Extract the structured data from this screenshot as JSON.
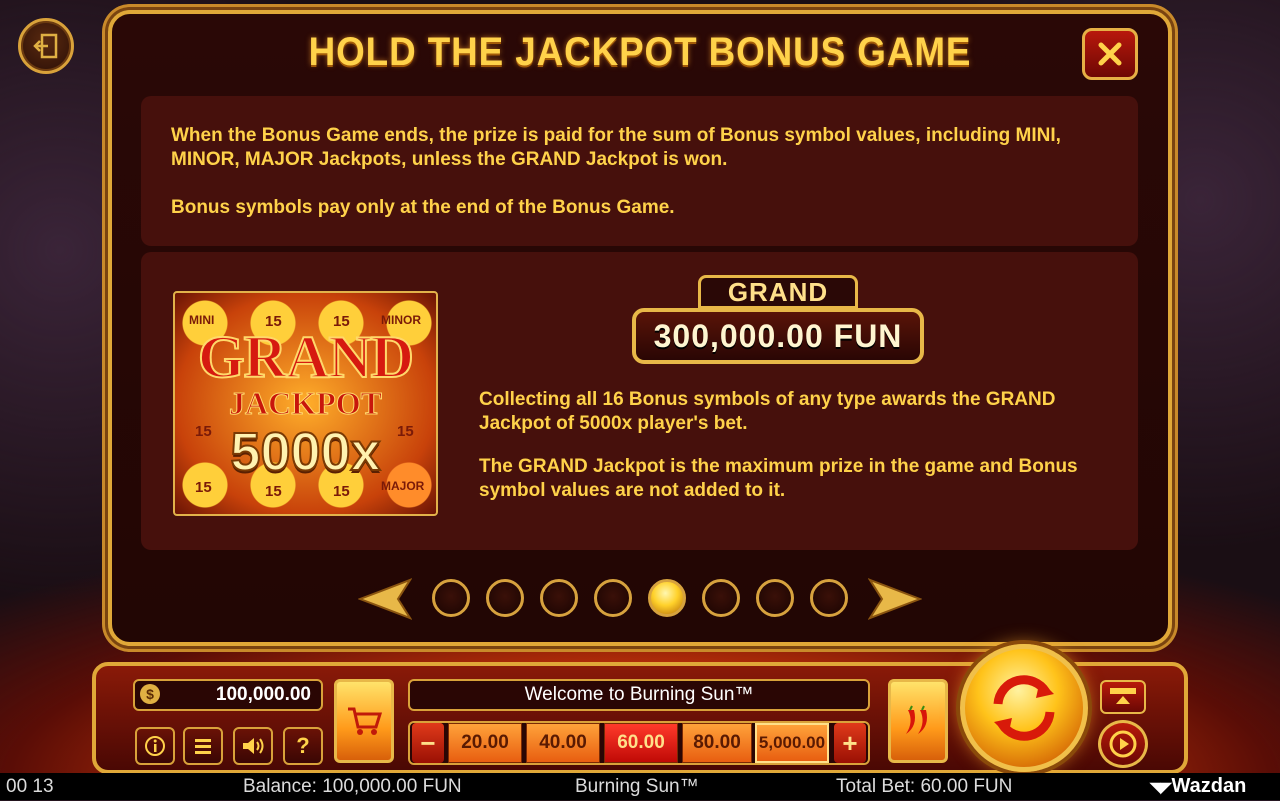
{
  "dialog": {
    "title": "HOLD THE JACKPOT BONUS GAME",
    "paragraph_1": "When the Bonus Game ends, the prize is paid for the sum of Bonus symbol values, including MINI, MINOR, MAJOR Jackpots, unless the GRAND Jackpot is won.",
    "paragraph_2": "Bonus symbols pay only at the end of the Bonus Game.",
    "paragraph_3": "Collecting all 16 Bonus symbols of any type awards the GRAND Jackpot of 5000x player's bet.",
    "paragraph_4": "The GRAND Jackpot is the maximum prize in the game and Bonus symbol values are not added to it."
  },
  "jackpot_image": {
    "grand": "GRAND",
    "jackpot": "JACKPOT",
    "multiplier": "5000x",
    "corner_labels": [
      "MINI",
      "MINOR",
      "MAJOR"
    ],
    "coin_value": "15"
  },
  "grand_badge": {
    "label": "GRAND",
    "amount": "300,000.00 FUN"
  },
  "pagination": {
    "page_count": 8,
    "active_page": 5
  },
  "controls": {
    "balance_value": "100,000.00",
    "welcome_message": "Welcome to Burning Sun™",
    "bet_options": [
      "20.00",
      "40.00",
      "60.00",
      "80.00",
      "5,000.00"
    ],
    "selected_bet": "60.00",
    "minus": "−",
    "plus": "+"
  },
  "status_bar": {
    "clock": "00 13",
    "balance": "Balance: 100,000.00 FUN",
    "game_name": "Burning Sun™",
    "total_bet": "Total Bet: 60.00 FUN",
    "brand": "Wazdan"
  },
  "colors": {
    "accent_gold": "#ffd24a",
    "frame_gold": "#e0a838",
    "panel_bg": "#46100c",
    "active_bet": "#e8160a"
  }
}
